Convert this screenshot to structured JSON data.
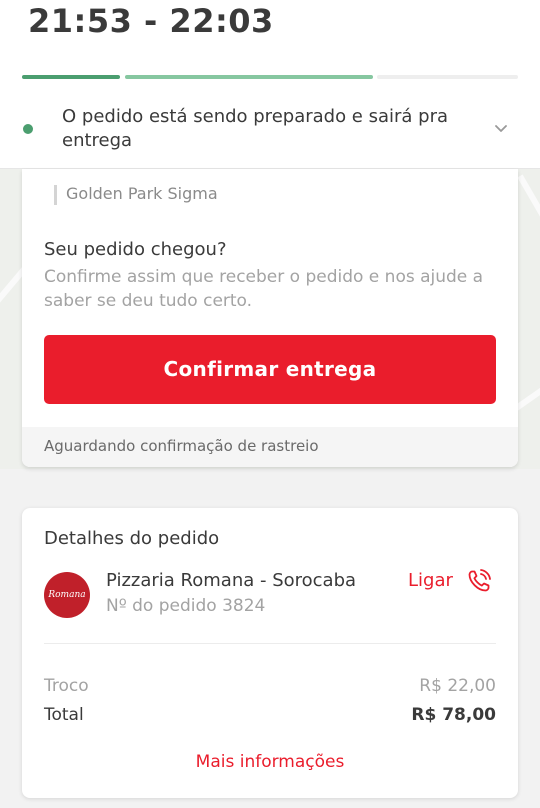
{
  "header": {
    "eta": "21:53 - 22:03",
    "progress": [
      {
        "state": "done"
      },
      {
        "state": "current"
      },
      {
        "state": "pending"
      }
    ],
    "status": "O pedido está sendo preparado e sairá pra entrega",
    "expand_icon": "chevron-down-icon"
  },
  "delivery_card": {
    "address": "Golden Park Sigma",
    "question_title": "Seu pedido chegou?",
    "question_body": "Confirme assim que receber o pedido e nos ajude a saber se deu tudo certo.",
    "confirm_label": "Confirmar entrega",
    "tracking_status": "Aguardando confirmação de rastreio"
  },
  "order_details": {
    "title": "Detalhes do pedido",
    "restaurant_logo_text": "Romana",
    "restaurant_name": "Pizzaria Romana - Sorocaba",
    "order_number": "Nº do pedido 3824",
    "call_label": "Ligar",
    "call_icon": "phone-icon",
    "change_label": "Troco",
    "change_value": "R$ 22,00",
    "total_label": "Total",
    "total_value": "R$ 78,00",
    "more_info_label": "Mais informações"
  },
  "colors": {
    "accent_red": "#ea1d2c",
    "progress_green": "#4b9e6f",
    "progress_light_green": "#86c7a0"
  }
}
